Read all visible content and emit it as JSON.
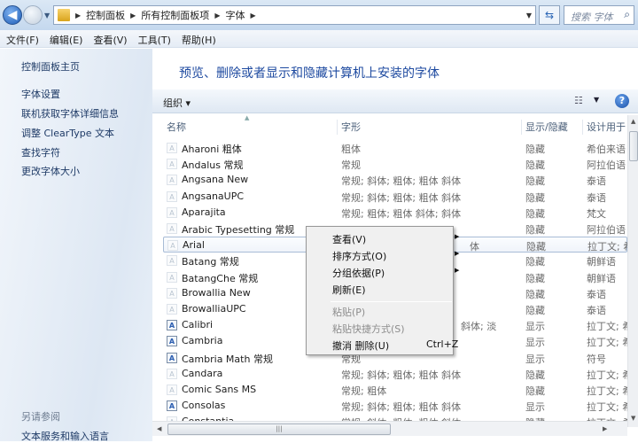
{
  "address": {
    "crumbs": [
      "控制面板",
      "所有控制面板项",
      "字体"
    ],
    "search_placeholder": "搜索 字体"
  },
  "menubar": [
    "文件(F)",
    "编辑(E)",
    "查看(V)",
    "工具(T)",
    "帮助(H)"
  ],
  "sidebar": {
    "home": "控制面板主页",
    "links": [
      "字体设置",
      "联机获取字体详细信息",
      "调整 ClearType 文本",
      "查找字符",
      "更改字体大小"
    ],
    "see_also": "另请参阅",
    "see_also_links": [
      "文本服务和输入语言"
    ]
  },
  "main": {
    "heading": "预览、删除或者显示和隐藏计算机上安装的字体",
    "organize": "组织 ▾",
    "columns": [
      "名称",
      "字形",
      "显示/隐藏",
      "设计用于"
    ],
    "rows": [
      {
        "name": "Aharoni 粗体",
        "style": "粗体",
        "show": "隐藏",
        "lang": "希伯来语",
        "icon": "font-icon"
      },
      {
        "name": "Andalus 常规",
        "style": "常规",
        "show": "隐藏",
        "lang": "阿拉伯语",
        "icon": "font-icon"
      },
      {
        "name": "Angsana New",
        "style": "常规; 斜体; 粗体; 粗体 斜体",
        "show": "隐藏",
        "lang": "泰语",
        "icon": "font-family-icon"
      },
      {
        "name": "AngsanaUPC",
        "style": "常规; 斜体; 粗体; 粗体 斜体",
        "show": "隐藏",
        "lang": "泰语",
        "icon": "font-family-icon"
      },
      {
        "name": "Aparajita",
        "style": "常规; 粗体; 粗体 斜体; 斜体",
        "show": "隐藏",
        "lang": "梵文",
        "icon": "font-family-icon"
      },
      {
        "name": "Arabic Typesetting 常规",
        "style": "",
        "show": "隐藏",
        "lang": "阿拉伯语",
        "icon": "font-icon"
      },
      {
        "name": "Arial",
        "style": "体",
        "show": "隐藏",
        "lang": "拉丁文; 希",
        "icon": "font-family-icon"
      },
      {
        "name": "Batang 常规",
        "style": "",
        "show": "隐藏",
        "lang": "朝鲜语",
        "icon": "font-icon"
      },
      {
        "name": "BatangChe 常规",
        "style": "",
        "show": "隐藏",
        "lang": "朝鲜语",
        "icon": "font-icon"
      },
      {
        "name": "Browallia New",
        "style": "",
        "show": "隐藏",
        "lang": "泰语",
        "icon": "font-family-icon"
      },
      {
        "name": "BrowalliaUPC",
        "style": "",
        "show": "隐藏",
        "lang": "泰语",
        "icon": "font-family-icon"
      },
      {
        "name": "Calibri",
        "style": "斜体; 淡",
        "show": "显示",
        "lang": "拉丁文; 希",
        "icon": "font-family-icon"
      },
      {
        "name": "Cambria",
        "style": "",
        "show": "显示",
        "lang": "拉丁文; 希",
        "icon": "font-family-icon"
      },
      {
        "name": "Cambria Math 常规",
        "style": "常规",
        "show": "显示",
        "lang": "符号",
        "icon": "font-icon"
      },
      {
        "name": "Candara",
        "style": "常规; 斜体; 粗体; 粗体 斜体",
        "show": "隐藏",
        "lang": "拉丁文; 希",
        "icon": "font-family-icon"
      },
      {
        "name": "Comic Sans MS",
        "style": "常规; 粗体",
        "show": "隐藏",
        "lang": "拉丁文; 希",
        "icon": "font-family-icon"
      },
      {
        "name": "Consolas",
        "style": "常规; 斜体; 粗体; 粗体 斜体",
        "show": "显示",
        "lang": "拉丁文; 希",
        "icon": "font-family-icon"
      },
      {
        "name": "Constantia",
        "style": "常规; 斜体; 粗体; 粗体 斜体",
        "show": "隐藏",
        "lang": "拉丁文; 希",
        "icon": "font-family-icon"
      }
    ]
  },
  "context_menu": {
    "items": [
      {
        "label": "查看(V)",
        "submenu": true,
        "disabled": false
      },
      {
        "label": "排序方式(O)",
        "submenu": true,
        "disabled": false
      },
      {
        "label": "分组依据(P)",
        "submenu": true,
        "disabled": false
      },
      {
        "label": "刷新(E)",
        "submenu": false,
        "disabled": false
      },
      {
        "label": "粘贴(P)",
        "submenu": false,
        "disabled": true
      },
      {
        "label": "粘贴快捷方式(S)",
        "submenu": false,
        "disabled": true
      },
      {
        "label": "撤消 删除(U)",
        "shortcut": "Ctrl+Z",
        "submenu": false,
        "disabled": false
      }
    ]
  }
}
